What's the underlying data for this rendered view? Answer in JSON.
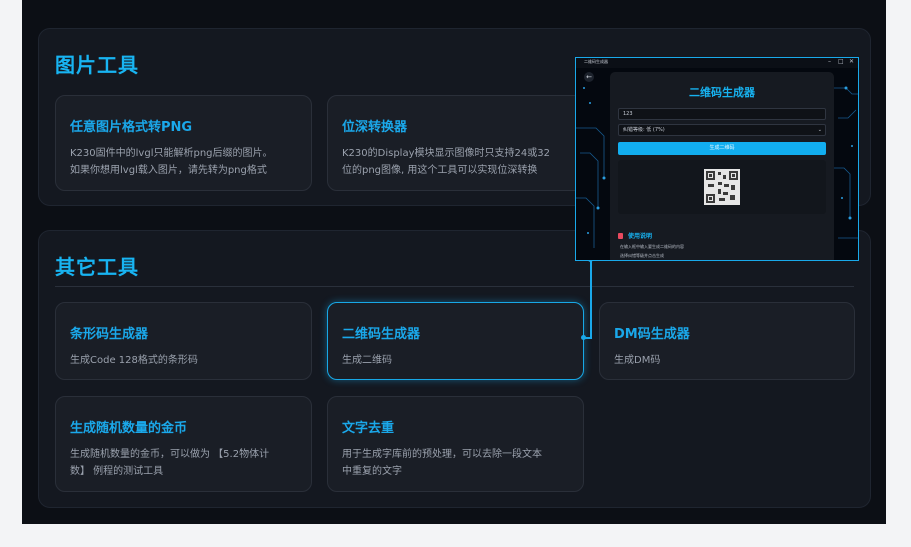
{
  "sections": {
    "image_tools": {
      "title": "图片工具",
      "cards": [
        {
          "title": "任意图片格式转PNG",
          "desc_line1": "K230固件中的lvgl只能解析png后缀的图片。",
          "desc_line2": "如果你想用lvgl载入图片，请先转为png格式"
        },
        {
          "title": "位深转换器",
          "desc_line1": "K230的Display模块显示图像时只支持24或32",
          "desc_line2": "位的png图像, 用这个工具可以实现位深转换"
        }
      ]
    },
    "other_tools": {
      "title": "其它工具",
      "cards": [
        {
          "title": "条形码生成器",
          "desc_line1": "生成Code 128格式的条形码",
          "desc_line2": ""
        },
        {
          "title": "二维码生成器",
          "desc_line1": "生成二维码",
          "desc_line2": ""
        },
        {
          "title": "DM码生成器",
          "desc_line1": "生成DM码",
          "desc_line2": ""
        },
        {
          "title": "生成随机数量的金币",
          "desc_line1": "生成随机数量的金币，可以做为 【5.2物体计",
          "desc_line2": "数】 例程的测试工具"
        },
        {
          "title": "文字去重",
          "desc_line1": "用于生成字库前的预处理，可以去除一段文本",
          "desc_line2": "中重复的文字"
        }
      ]
    }
  },
  "preview": {
    "window_title": "二维码生成器",
    "window_controls": {
      "minimize": "–",
      "maximize": "□",
      "close": "✕"
    },
    "back_icon": "arrow-left-icon",
    "heading": "二维码生成器",
    "input_value": "123",
    "select_value": "纠错等级: 低 (7%)",
    "generate_label": "生成二维码",
    "help_title": "使用说明",
    "help_items": [
      "在输入框中输入要生成二维码的内容",
      "选择纠错等级并点击生成"
    ]
  },
  "colors": {
    "accent": "#18b4f2",
    "page_bg": "#0c0f15",
    "panel_bg": "#141820",
    "card_bg": "#1a1e26"
  }
}
